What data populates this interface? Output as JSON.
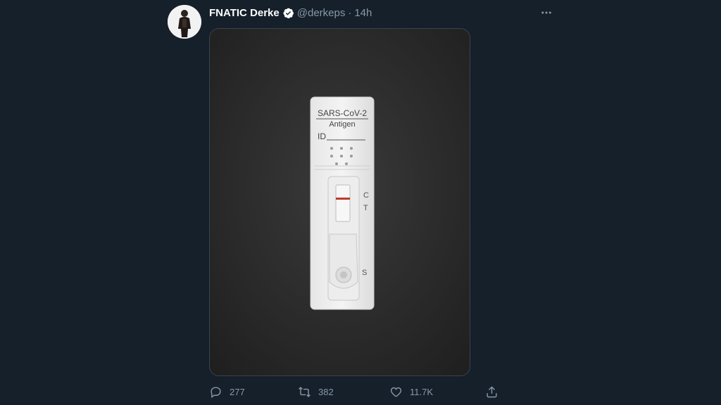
{
  "tweet": {
    "author_name": "FNATIC Derke",
    "handle": "@derkeps",
    "separator": "·",
    "time": "14h",
    "avatar_icon": "user-avatar",
    "more_icon": "more-horizontal-icon"
  },
  "media": {
    "test_label_line1": "SARS-CoV-2",
    "test_label_line2": "Antigen",
    "id_label": "ID",
    "marker_c": "C",
    "marker_t": "T",
    "marker_s": "S"
  },
  "actions": {
    "replies": "277",
    "retweets": "382",
    "likes": "11.7K"
  },
  "colors": {
    "background": "#15202b",
    "secondary_text": "#8899a6",
    "verified": "#ffffff",
    "test_line": "#c0392b"
  }
}
